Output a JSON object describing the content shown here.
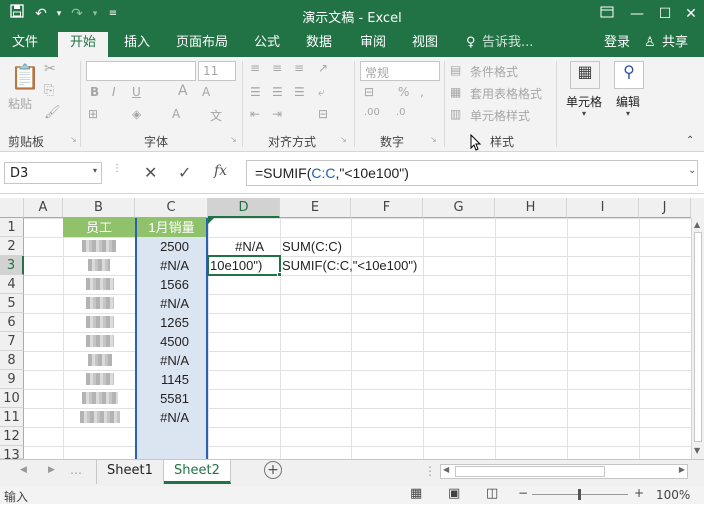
{
  "window": {
    "title": "演示文稿 - Excel"
  },
  "titlebar": {
    "save_icon": "save-icon",
    "undo_icon": "undo-icon",
    "redo_icon": "redo-icon",
    "qa_icon": "customize-icon"
  },
  "menu": {
    "tabs": [
      "文件",
      "开始",
      "插入",
      "页面布局",
      "公式",
      "数据",
      "审阅",
      "视图"
    ],
    "active_tab": "开始",
    "tell_me": "告诉我...",
    "login": "登录",
    "share": "共享"
  },
  "ribbon": {
    "clipboard": {
      "paste": "粘贴",
      "label": "剪贴板"
    },
    "font": {
      "size": "11",
      "label": "字体"
    },
    "alignment": {
      "label": "对齐方式"
    },
    "number": {
      "format": "常规",
      "label": "数字"
    },
    "styles": {
      "conditional": "条件格式",
      "table": "套用表格格式",
      "cell": "单元格样式",
      "label": "样式"
    },
    "cells": {
      "label": "单元格"
    },
    "editing": {
      "label": "编辑"
    }
  },
  "formula_bar": {
    "name_box": "D3",
    "formula": "=SUMIF(C:C,\"<10e100\")",
    "formula_prefix": "=SUMIF(",
    "formula_ref": "C:C",
    "formula_suffix": ",\"<10e100\")"
  },
  "sheet": {
    "columns": [
      "A",
      "B",
      "C",
      "D",
      "E",
      "F",
      "G",
      "H",
      "I",
      "J"
    ],
    "rows": [
      "1",
      "2",
      "3",
      "4",
      "5",
      "6",
      "7",
      "8",
      "9",
      "10",
      "11",
      "12",
      "13"
    ],
    "header_b": "员工",
    "header_c": "1月销量",
    "c_values": [
      "2500",
      "#N/A",
      "1566",
      "#N/A",
      "1265",
      "4500",
      "#N/A",
      "1145",
      "5581",
      "#N/A"
    ],
    "d2": "#N/A",
    "d3": "10e100\")",
    "e2": "SUM(C:C)",
    "e3": "SUMIF(C:C,\"<10e100\")"
  },
  "sheets": {
    "tabs": [
      "Sheet1",
      "Sheet2"
    ],
    "active": "Sheet2"
  },
  "status": {
    "mode": "输入",
    "zoom": "100%"
  },
  "colors": {
    "accent": "#217346",
    "header_fill": "#8fc26b",
    "col_c_fill": "#dbe5f1"
  }
}
